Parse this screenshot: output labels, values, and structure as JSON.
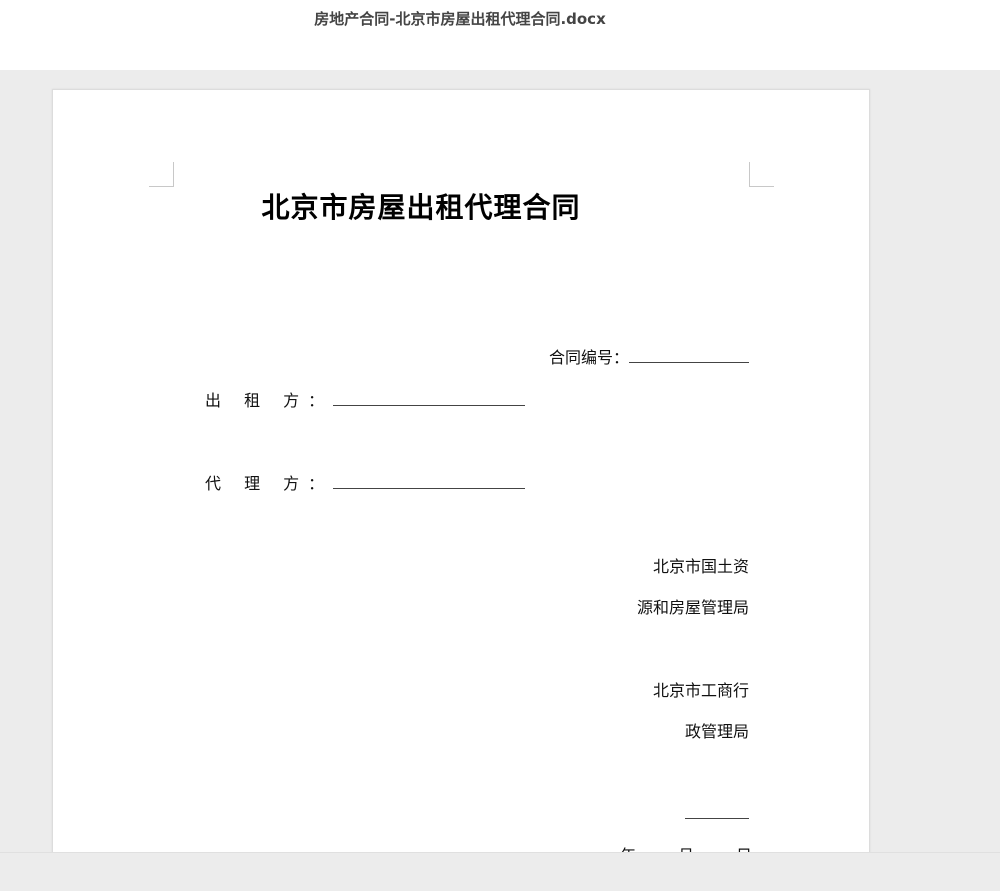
{
  "window": {
    "file_name": "房地产合同-北京市房屋出租代理合同.docx"
  },
  "document": {
    "title": "北京市房屋出租代理合同",
    "contract_no_label": "合同编号：",
    "lessor_label": "出 租 方：",
    "agent_label": "代 理 方：",
    "authority_1_line1": "北京市国土资",
    "authority_1_line2": "源和房屋管理局",
    "authority_2_line1": "北京市工商行",
    "authority_2_line2": "政管理局",
    "date_year": "年",
    "date_month": "月",
    "date_day": "日"
  }
}
